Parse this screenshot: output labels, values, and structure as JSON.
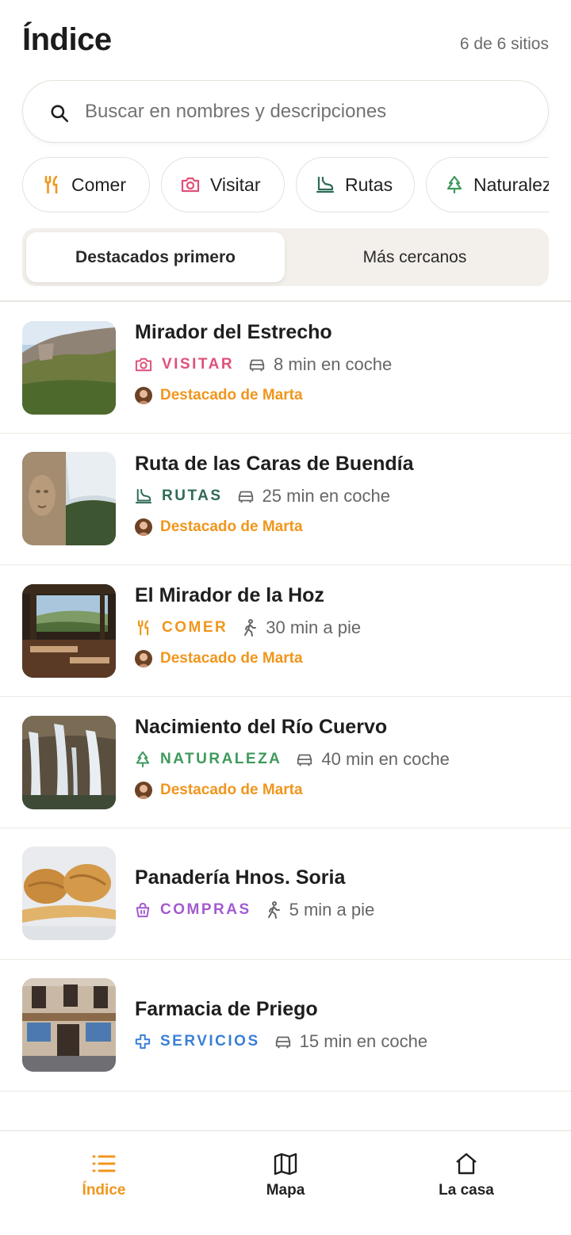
{
  "header": {
    "title": "Índice",
    "count": "6 de 6 sitios"
  },
  "search": {
    "placeholder": "Buscar en nombres y descripciones"
  },
  "chips": [
    {
      "label": "Comer",
      "icon": "fork-knife-icon",
      "color": "#f0961c"
    },
    {
      "label": "Visitar",
      "icon": "camera-icon",
      "color": "#e0507a"
    },
    {
      "label": "Rutas",
      "icon": "boot-icon",
      "color": "#2e6b55"
    },
    {
      "label": "Naturaleza",
      "icon": "tree-icon",
      "color": "#3e9a5c"
    }
  ],
  "sort": {
    "active": "Destacados primero",
    "inactive": "Más cercanos"
  },
  "places": [
    {
      "name": "Mirador del Estrecho",
      "category": "VISITAR",
      "category_color": "#e0507a",
      "category_icon": "camera-icon",
      "distance": "8 min en coche",
      "distance_icon": "car-icon",
      "featured": "Destacado de Marta"
    },
    {
      "name": "Ruta de las Caras de Buendía",
      "category": "RUTAS",
      "category_color": "#2e6b55",
      "category_icon": "boot-icon",
      "distance": "25 min en coche",
      "distance_icon": "car-icon",
      "featured": "Destacado de Marta"
    },
    {
      "name": "El Mirador de la Hoz",
      "category": "COMER",
      "category_color": "#f0961c",
      "category_icon": "fork-knife-icon",
      "distance": "30 min a pie",
      "distance_icon": "walk-icon",
      "featured": "Destacado de Marta"
    },
    {
      "name": "Nacimiento del Río Cuervo",
      "category": "NATURALEZA",
      "category_color": "#3e9a5c",
      "category_icon": "tree-icon",
      "distance": "40 min en coche",
      "distance_icon": "car-icon",
      "featured": "Destacado de Marta"
    },
    {
      "name": "Panadería Hnos. Soria",
      "category": "COMPRAS",
      "category_color": "#a35ad0",
      "category_icon": "basket-icon",
      "distance": "5 min a pie",
      "distance_icon": "walk-icon",
      "featured": ""
    },
    {
      "name": "Farmacia de Priego",
      "category": "SERVICIOS",
      "category_color": "#3a7fd5",
      "category_icon": "cross-icon",
      "distance": "15 min en coche",
      "distance_icon": "car-icon",
      "featured": ""
    }
  ],
  "nav": [
    {
      "label": "Índice",
      "icon": "list-icon",
      "active": true,
      "color": "#f0961c"
    },
    {
      "label": "Mapa",
      "icon": "map-icon",
      "active": false
    },
    {
      "label": "La casa",
      "icon": "home-icon",
      "active": false
    }
  ]
}
